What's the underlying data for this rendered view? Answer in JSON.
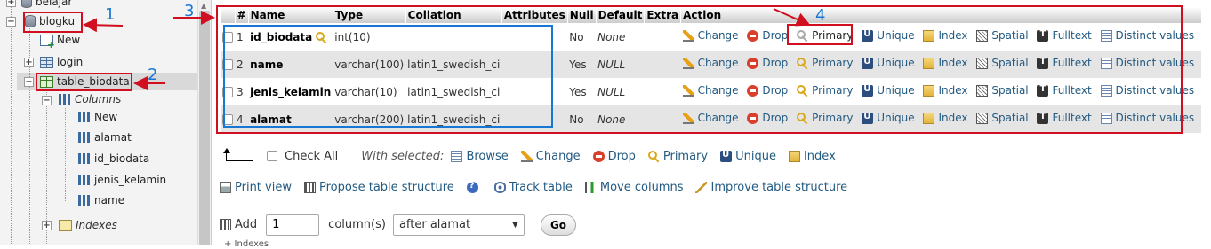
{
  "nav": {
    "partial_top_item": "belajar",
    "db": "blogku",
    "items": [
      {
        "label": "New"
      },
      {
        "label": "login"
      },
      {
        "label": "table_biodata"
      }
    ],
    "columns_label": "Columns",
    "columns": [
      "New",
      "alamat",
      "id_biodata",
      "jenis_kelamin",
      "name"
    ],
    "indexes_label": "Indexes"
  },
  "table": {
    "headers": [
      "#",
      "Name",
      "Type",
      "Collation",
      "Attributes",
      "Null",
      "Default",
      "Extra",
      "Action"
    ],
    "rows": [
      {
        "num": "1",
        "name": "id_biodata",
        "type": "int(10)",
        "collation": "",
        "null": "No",
        "default": "None"
      },
      {
        "num": "2",
        "name": "name",
        "type": "varchar(100)",
        "collation": "latin1_swedish_ci",
        "null": "Yes",
        "default": "NULL"
      },
      {
        "num": "3",
        "name": "jenis_kelamin",
        "type": "varchar(10)",
        "collation": "latin1_swedish_ci",
        "null": "Yes",
        "default": "NULL"
      },
      {
        "num": "4",
        "name": "alamat",
        "type": "varchar(200)",
        "collation": "latin1_swedish_ci",
        "null": "No",
        "default": "None"
      }
    ],
    "actions": {
      "change": "Change",
      "drop": "Drop",
      "primary": "Primary",
      "unique": "Unique",
      "index": "Index",
      "spatial": "Spatial",
      "fulltext": "Fulltext",
      "distinct": "Distinct values"
    }
  },
  "bulk": {
    "check_all": "Check All",
    "with_selected": "With selected:",
    "browse": "Browse",
    "change": "Change",
    "drop": "Drop",
    "primary": "Primary",
    "unique": "Unique",
    "index": "Index"
  },
  "links": {
    "print_view": "Print view",
    "propose": "Propose table structure",
    "track": "Track table",
    "move_columns": "Move columns",
    "improve": "Improve table structure"
  },
  "add": {
    "label": "Add",
    "count": "1",
    "columns_label": "column(s)",
    "position": "after alamat",
    "go": "Go"
  },
  "bottom_hint": "+ Indexes",
  "annotations": {
    "n1": "1",
    "n2": "2",
    "n3": "3",
    "n4": "4"
  },
  "colors": {
    "annotation_red": "#d01020",
    "annotation_blue": "#1877d2",
    "link": "#235a81"
  }
}
